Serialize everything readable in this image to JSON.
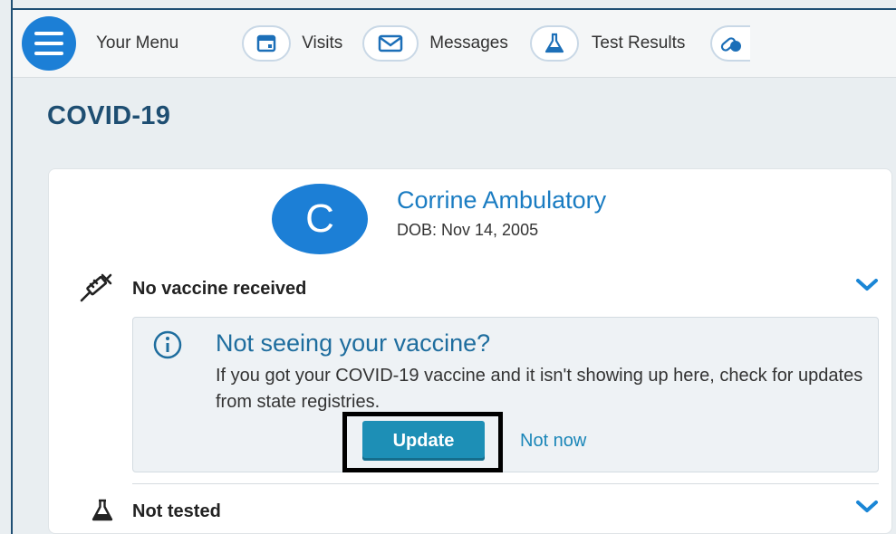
{
  "nav": {
    "menu_label": "Your Menu",
    "items": [
      {
        "label": "Visits",
        "icon": "calendar-icon"
      },
      {
        "label": "Messages",
        "icon": "envelope-icon"
      },
      {
        "label": "Test Results",
        "icon": "flask-icon"
      },
      {
        "label": "",
        "icon": "pills-icon"
      }
    ]
  },
  "page": {
    "title": "COVID-19"
  },
  "patient": {
    "initial": "C",
    "name": "Corrine Ambulatory",
    "dob": "DOB: Nov 14, 2005"
  },
  "vaccine": {
    "status": "No vaccine received",
    "notice_title": "Not seeing your vaccine?",
    "notice_text": "If you got your COVID-19 vaccine and it isn't showing up here, check for updates from state registries.",
    "update_label": "Update",
    "not_now_label": "Not now"
  },
  "testing": {
    "status": "Not tested"
  },
  "colors": {
    "accent": "#1c7fd6",
    "title": "#1e4e72",
    "button": "#1d8fb6",
    "chevron": "#1a86d6"
  }
}
